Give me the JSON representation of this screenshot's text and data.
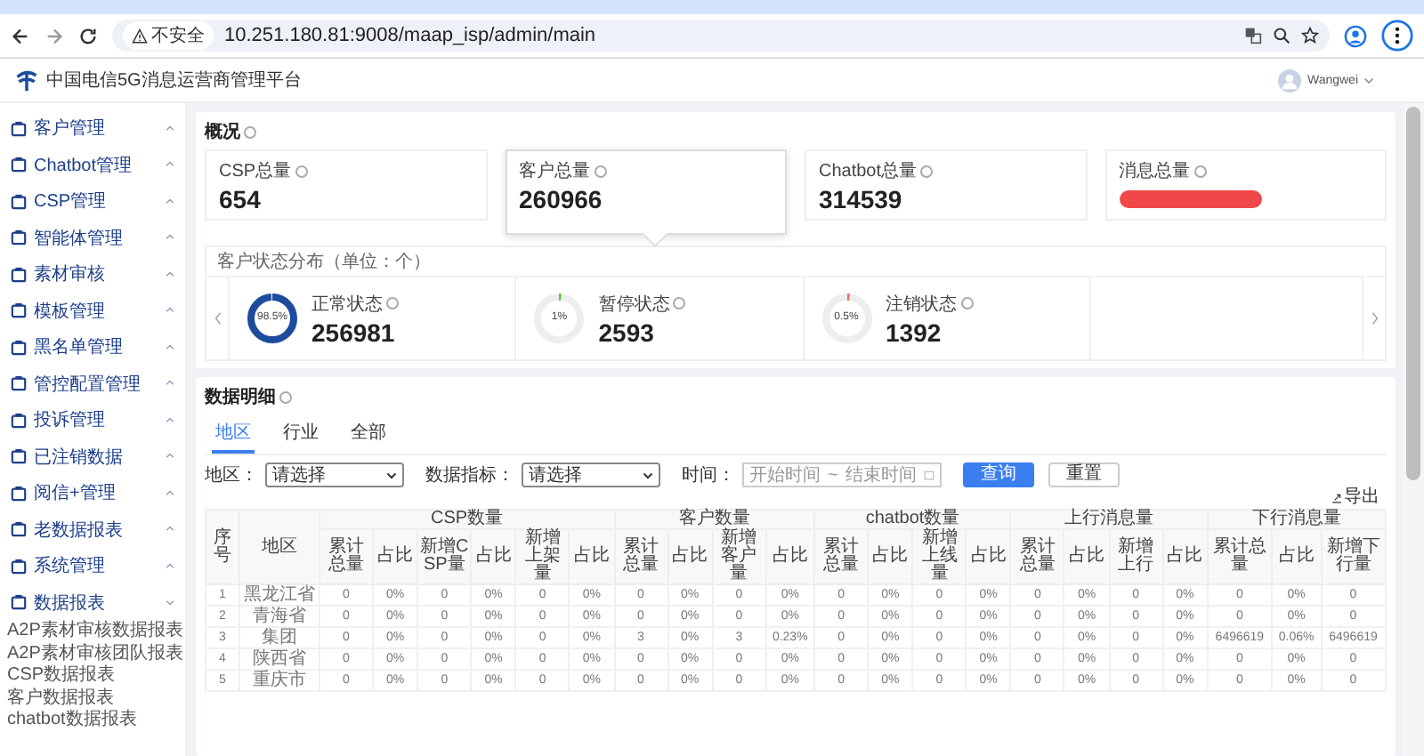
{
  "browser": {
    "security_label": "不安全",
    "url": "10.251.180.81:9008/maap_isp/admin/main"
  },
  "header": {
    "title": "中国电信5G消息运营商管理平台",
    "user": "Wangwei"
  },
  "sidebar": {
    "items": [
      {
        "label": "客户管理",
        "expanded": false
      },
      {
        "label": "Chatbot管理",
        "expanded": false
      },
      {
        "label": "CSP管理",
        "expanded": false
      },
      {
        "label": "智能体管理",
        "expanded": false
      },
      {
        "label": "素材审核",
        "expanded": false
      },
      {
        "label": "模板管理",
        "expanded": false
      },
      {
        "label": "黑名单管理",
        "expanded": false
      },
      {
        "label": "管控配置管理",
        "expanded": false
      },
      {
        "label": "投诉管理",
        "expanded": false
      },
      {
        "label": "已注销数据",
        "expanded": false
      },
      {
        "label": "阅信+管理",
        "expanded": false
      },
      {
        "label": "老数据报表",
        "expanded": false
      },
      {
        "label": "系统管理",
        "expanded": false
      },
      {
        "label": "数据报表",
        "expanded": true,
        "children": [
          {
            "label": "A2P素材审核数据报表"
          },
          {
            "label": "A2P素材审核团队报表"
          },
          {
            "label": "CSP数据报表"
          },
          {
            "label": "客户数据报表"
          },
          {
            "label": "chatbot数据报表"
          }
        ]
      }
    ]
  },
  "overview": {
    "title": "概况",
    "cards": [
      {
        "label": "CSP总量",
        "value": "654",
        "selected": false,
        "redacted": false
      },
      {
        "label": "客户总量",
        "value": "260966",
        "selected": true,
        "redacted": false
      },
      {
        "label": "Chatbot总量",
        "value": "314539",
        "selected": false,
        "redacted": false
      },
      {
        "label": "消息总量",
        "selected": false,
        "redacted": true
      }
    ],
    "distribution": {
      "title": "客户状态分布（单位：个）",
      "items": [
        {
          "label": "正常状态",
          "value": "256981",
          "percent": "98.5%",
          "level": 0.985,
          "color": "#1d4c9e"
        },
        {
          "label": "暂停状态",
          "value": "2593",
          "percent": "1%",
          "level": 0.01,
          "color": "#67c23a"
        },
        {
          "label": "注销状态",
          "value": "1392",
          "percent": "0.5%",
          "level": 0.005,
          "color": "#f56c6c"
        }
      ]
    }
  },
  "details": {
    "title": "数据明细",
    "tabs": [
      {
        "label": "地区",
        "selected": true
      },
      {
        "label": "行业",
        "selected": false
      },
      {
        "label": "全部",
        "selected": false
      }
    ],
    "filters": {
      "region_label": "地区：",
      "region_placeholder": "请选择",
      "metric_label": "数据指标：",
      "metric_placeholder": "请选择",
      "time_label": "时间：",
      "start_placeholder": "开始时间",
      "separator": "~",
      "end_placeholder": "结束时间"
    },
    "buttons": [
      {
        "label": "查询",
        "kind": "primary"
      },
      {
        "label": "重置",
        "kind": "default"
      }
    ],
    "export_label": "导出",
    "table": {
      "index_header": "序号",
      "region_header": "地区",
      "groups": [
        {
          "label": "CSP数量",
          "columns": [
            "累计总量",
            "占比",
            "新增CSP量",
            "占比",
            "新增上架量",
            "占比"
          ]
        },
        {
          "label": "客户数量",
          "columns": [
            "累计总量",
            "占比",
            "新增客户量",
            "占比"
          ]
        },
        {
          "label": "chatbot数量",
          "columns": [
            "累计总量",
            "占比",
            "新增上线量",
            "占比"
          ]
        },
        {
          "label": "上行消息量",
          "columns": [
            "累计总量",
            "占比",
            "新增上行",
            "占比"
          ]
        },
        {
          "label": "下行消息量",
          "columns": [
            "累计总量",
            "占比",
            "新增下行量"
          ]
        }
      ],
      "rows": [
        {
          "index": "1",
          "region": "黑龙江省",
          "cells": [
            "0",
            "0%",
            "0",
            "0%",
            "0",
            "0%",
            "0",
            "0%",
            "0",
            "0%",
            "0",
            "0%",
            "0",
            "0%",
            "0",
            "0%",
            "0",
            "0%",
            "0",
            "0%",
            "0"
          ]
        },
        {
          "index": "2",
          "region": "青海省",
          "cells": [
            "0",
            "0%",
            "0",
            "0%",
            "0",
            "0%",
            "0",
            "0%",
            "0",
            "0%",
            "0",
            "0%",
            "0",
            "0%",
            "0",
            "0%",
            "0",
            "0%",
            "0",
            "0%",
            "0"
          ]
        },
        {
          "index": "3",
          "region": "集团",
          "cells": [
            "0",
            "0%",
            "0",
            "0%",
            "0",
            "0%",
            "3",
            "0%",
            "3",
            "0.23%",
            "0",
            "0%",
            "0",
            "0%",
            "0",
            "0%",
            "0",
            "0%",
            "6496619",
            "0.06%",
            "6496619"
          ]
        },
        {
          "index": "4",
          "region": "陕西省",
          "cells": [
            "0",
            "0%",
            "0",
            "0%",
            "0",
            "0%",
            "0",
            "0%",
            "0",
            "0%",
            "0",
            "0%",
            "0",
            "0%",
            "0",
            "0%",
            "0",
            "0%",
            "0",
            "0%",
            "0"
          ]
        },
        {
          "index": "5",
          "region": "重庆市",
          "cells": [
            "0",
            "0%",
            "0",
            "0%",
            "0",
            "0%",
            "0",
            "0%",
            "0",
            "0%",
            "0",
            "0%",
            "0",
            "0%",
            "0",
            "0%",
            "0",
            "0%",
            "0",
            "0%",
            "0"
          ]
        }
      ]
    }
  }
}
